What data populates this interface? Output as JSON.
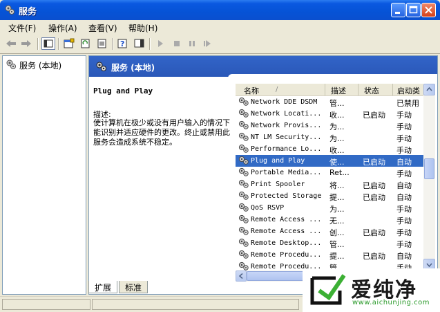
{
  "window": {
    "title": "服务"
  },
  "menu": [
    "文件(F)",
    "操作(A)",
    "查看(V)",
    "帮助(H)"
  ],
  "tree": {
    "root": "服务 (本地)"
  },
  "pane": {
    "header": "服务 (本地)",
    "selected_name": "Plug and Play",
    "desc_label": "描述:",
    "desc_text": "使计算机在极少或没有用户输入的情况下能识别并适应硬件的更改。终止或禁用此服务会造成系统不稳定。"
  },
  "list": {
    "columns": {
      "name": "名称",
      "sort_glyph": "/",
      "desc": "描述",
      "status": "状态",
      "startup": "启动类"
    },
    "rows": [
      {
        "name": "Network DDE DSDM",
        "desc": "管...",
        "status": "",
        "startup": "已禁用"
      },
      {
        "name": "Network Locati...",
        "desc": "收...",
        "status": "已启动",
        "startup": "手动"
      },
      {
        "name": "Network Provis...",
        "desc": "为...",
        "status": "",
        "startup": "手动"
      },
      {
        "name": "NT LM Security...",
        "desc": "为...",
        "status": "",
        "startup": "手动"
      },
      {
        "name": "Performance Lo...",
        "desc": "收...",
        "status": "",
        "startup": "手动"
      },
      {
        "name": "Plug and Play",
        "desc": "使...",
        "status": "已启动",
        "startup": "自动",
        "selected": true
      },
      {
        "name": "Portable Media...",
        "desc": "Ret...",
        "status": "",
        "startup": "手动"
      },
      {
        "name": "Print Spooler",
        "desc": "将...",
        "status": "已启动",
        "startup": "自动"
      },
      {
        "name": "Protected Storage",
        "desc": "提...",
        "status": "已启动",
        "startup": "自动"
      },
      {
        "name": "QoS RSVP",
        "desc": "为...",
        "status": "",
        "startup": "手动"
      },
      {
        "name": "Remote Access ...",
        "desc": "无...",
        "status": "",
        "startup": "手动"
      },
      {
        "name": "Remote Access ...",
        "desc": "创...",
        "status": "已启动",
        "startup": "手动"
      },
      {
        "name": "Remote Desktop...",
        "desc": "管...",
        "status": "",
        "startup": "手动"
      },
      {
        "name": "Remote Procedu...",
        "desc": "提...",
        "status": "已启动",
        "startup": "自动"
      },
      {
        "name": "Remote Procedu...",
        "desc": "管...",
        "status": "",
        "startup": "手动"
      }
    ]
  },
  "tabs": [
    "扩展",
    "标准"
  ],
  "watermark": {
    "text": "爱纯净",
    "url": "www.aichunjing.com"
  },
  "colors": {
    "title_blue": "#0653d6",
    "selection": "#316ac5",
    "pane_header": "#2a58b8"
  }
}
